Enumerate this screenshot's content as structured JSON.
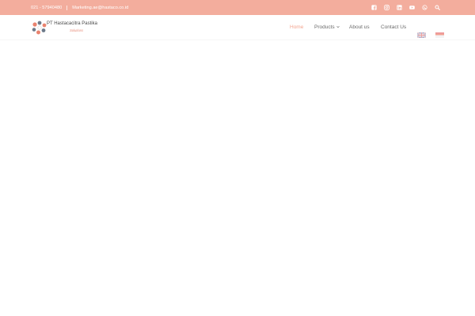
{
  "topbar": {
    "background": "#f3ad9d",
    "phone": "021 - 57940480",
    "email": "Marketing.ae@hastaco.co.id",
    "icons": [
      "facebook-icon",
      "instagram-icon",
      "linkedin-icon",
      "youtube-icon",
      "whatsapp-icon",
      "search-icon"
    ]
  },
  "header": {
    "logo": {
      "name": "PT Hastacacitra Pastika",
      "tagline": "Solutions"
    },
    "menu": {
      "home": "Home",
      "products": "Products",
      "about": "About us",
      "contact": "Contact Us"
    },
    "accent_color": "#f3a48f",
    "languages": [
      "english-flag-icon",
      "indonesia-flag-icon"
    ]
  }
}
